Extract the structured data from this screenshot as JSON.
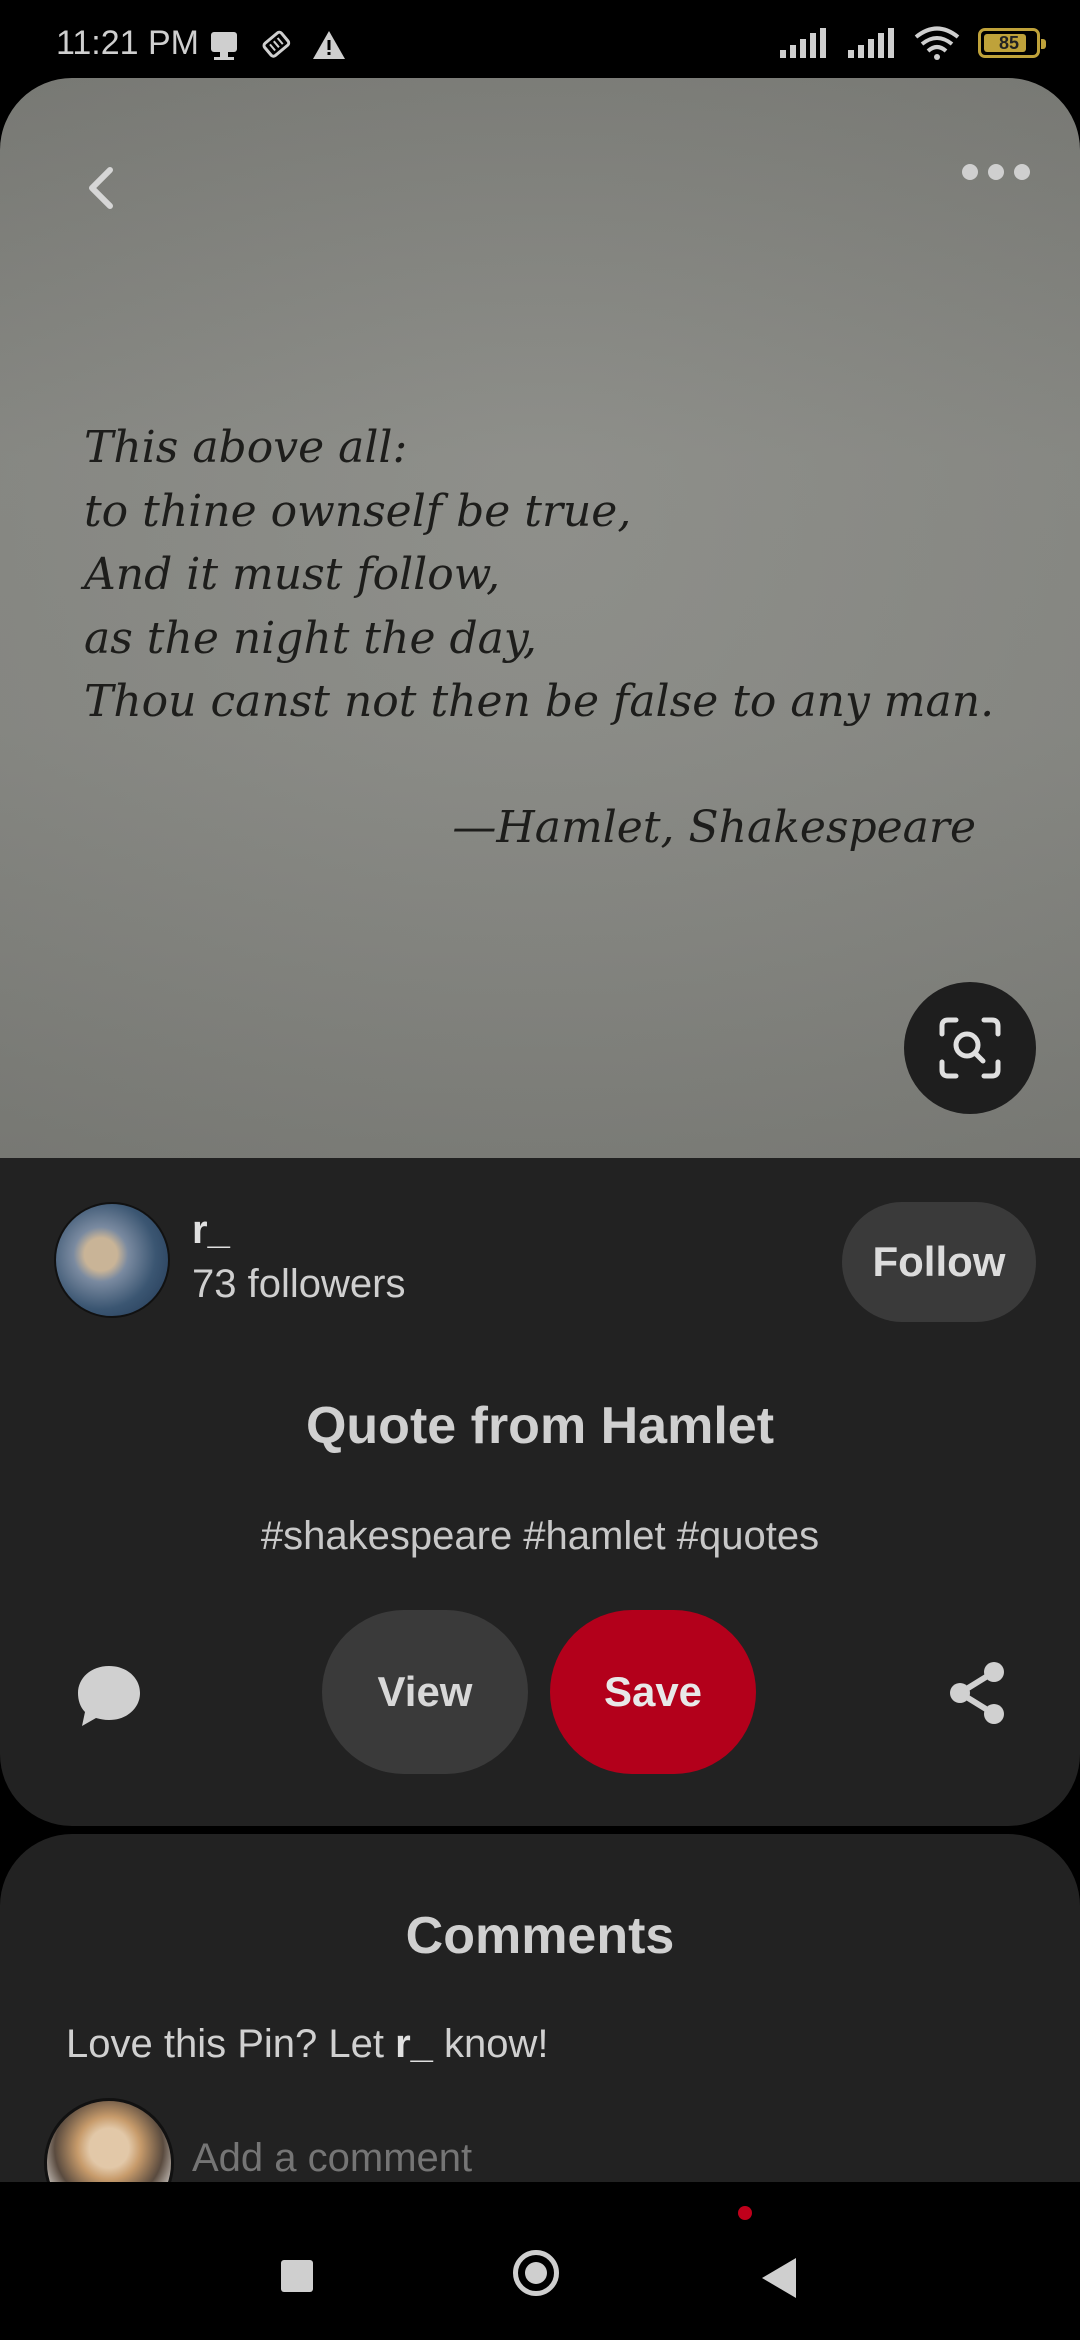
{
  "status_bar": {
    "time": "11:21 PM",
    "battery": "85",
    "left_icons": [
      "notification-icon",
      "sim-card-icon",
      "warning-icon"
    ],
    "right_icons": [
      "signal-icon",
      "signal-icon",
      "wifi-icon",
      "battery-icon"
    ]
  },
  "pin": {
    "quote_lines": [
      "This above all:",
      "to thine ownself be true,",
      "And it must follow,",
      "as the night the day,",
      "Thou canst not then be false to any man."
    ],
    "attribution": "—Hamlet, Shakespeare",
    "back_icon": "chevron-left-icon",
    "more_icon": "more-horizontal-icon",
    "lens_icon": "visual-search-icon"
  },
  "creator": {
    "name": "r_",
    "followers": "73 followers",
    "follow_label": "Follow"
  },
  "details": {
    "title": "Quote from Hamlet",
    "tags": "#shakespeare #hamlet #quotes",
    "view_label": "View",
    "save_label": "Save"
  },
  "comments": {
    "title": "Comments",
    "prompt_before": "Love this Pin? Let ",
    "prompt_name": "r_",
    "prompt_after": " know!",
    "placeholder": "Add a comment"
  },
  "colors": {
    "background": "#000000",
    "card": "#222222",
    "save": "#b3001b",
    "secondary_button": "#3a3a3a",
    "battery": "#bfa23a"
  }
}
